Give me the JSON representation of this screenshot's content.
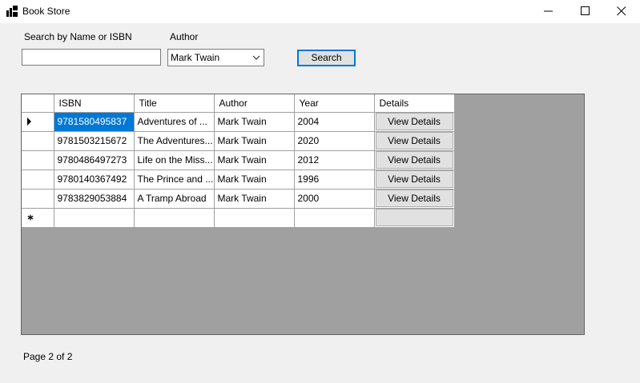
{
  "window": {
    "title": "Book Store"
  },
  "search": {
    "label": "Search by Name or ISBN",
    "value": "",
    "placeholder": ""
  },
  "author": {
    "label": "Author",
    "selected": "Mark Twain"
  },
  "search_button": {
    "label": "Search"
  },
  "grid": {
    "columns": [
      "ISBN",
      "Title",
      "Author",
      "Year",
      "Details"
    ],
    "rows": [
      {
        "isbn": "9781580495837",
        "title": "Adventures of ...",
        "author": "Mark Twain",
        "year": "2004",
        "details": "View Details"
      },
      {
        "isbn": "9781503215672",
        "title": "The Adventures...",
        "author": "Mark Twain",
        "year": "2020",
        "details": "View Details"
      },
      {
        "isbn": "9780486497273",
        "title": "Life on the Miss...",
        "author": "Mark Twain",
        "year": "2012",
        "details": "View Details"
      },
      {
        "isbn": "9780140367492",
        "title": "The Prince and ...",
        "author": "Mark Twain",
        "year": "1996",
        "details": "View Details"
      },
      {
        "isbn": "9783829053884",
        "title": "A Tramp Abroad",
        "author": "Mark Twain",
        "year": "2000",
        "details": "View Details"
      }
    ],
    "new_row": {
      "isbn": "",
      "title": "",
      "author": "",
      "year": "",
      "details": ""
    }
  },
  "pagination": {
    "label": "Page 2 of 2"
  },
  "colors": {
    "selection": "#0078d7",
    "grid_background": "#a0a0a0",
    "window_background": "#f0f0f0"
  },
  "icons": {
    "app": "app-window-icon",
    "current_row": "triangle-right-icon",
    "new_row": "asterisk-icon"
  }
}
